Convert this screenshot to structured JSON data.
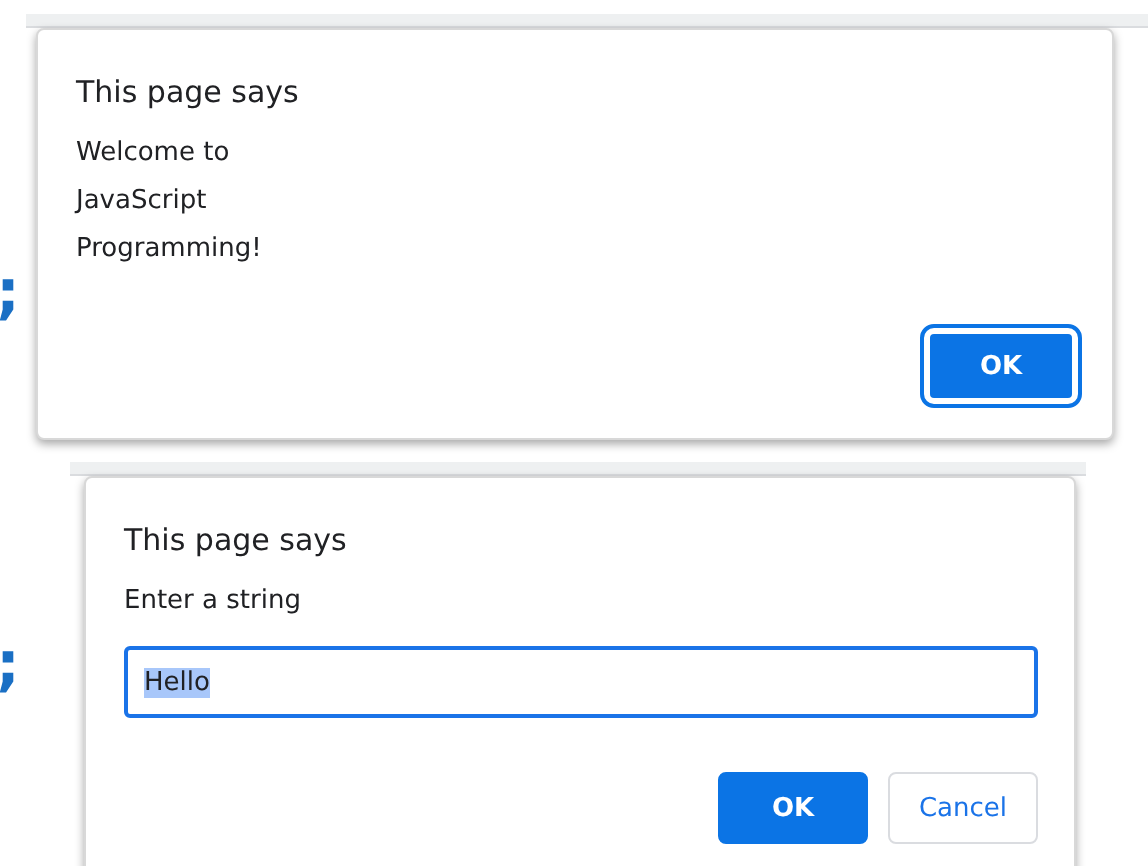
{
  "dialogs": [
    {
      "kind": "alert",
      "fragment": ";",
      "title": "This page says",
      "message_lines": [
        "Welcome to",
        "JavaScript",
        "Programming!"
      ],
      "buttons": [
        {
          "label": "OK",
          "kind": "primary",
          "focused": true
        }
      ]
    },
    {
      "kind": "prompt",
      "fragment": ";",
      "title": "This page says",
      "message_lines": [
        "Enter a string"
      ],
      "input": {
        "value": "Hello",
        "text_selected": true
      },
      "buttons": [
        {
          "label": "OK",
          "kind": "primary",
          "focused": false
        },
        {
          "label": "Cancel",
          "kind": "secondary",
          "focused": false
        }
      ]
    }
  ]
}
